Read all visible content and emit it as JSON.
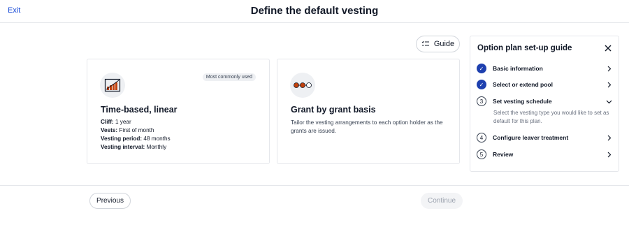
{
  "header": {
    "exit_label": "Exit",
    "title": "Define the default vesting"
  },
  "guide_button": {
    "label": "Guide",
    "icon": "checklist-icon"
  },
  "cards": [
    {
      "icon": "linear-chart-icon",
      "badge": "Most commonly used",
      "title": "Time-based, linear",
      "details": [
        {
          "key": "Cliff:",
          "value": "1 year"
        },
        {
          "key": "Vests:",
          "value": "First of month"
        },
        {
          "key": "Vesting period:",
          "value": "48 months"
        },
        {
          "key": "Vesting interval:",
          "value": "Monthly"
        }
      ]
    },
    {
      "icon": "grant-dots-icon",
      "title": "Grant by grant basis",
      "description": "Tailor the vesting arrangements to each option holder as the grants are issued."
    }
  ],
  "guide_panel": {
    "title": "Option plan set-up guide",
    "steps": [
      {
        "marker": "✓",
        "label": "Basic information",
        "status": "complete"
      },
      {
        "marker": "✓",
        "label": "Select or extend pool",
        "status": "complete"
      },
      {
        "marker": "3",
        "label": "Set vesting schedule",
        "status": "current",
        "description": "Select the vesting type you would like to set as default for this plan."
      },
      {
        "marker": "4",
        "label": "Configure leaver treatment",
        "status": "pending"
      },
      {
        "marker": "5",
        "label": "Review",
        "status": "pending"
      }
    ]
  },
  "footer": {
    "previous_label": "Previous",
    "continue_label": "Continue"
  },
  "colors": {
    "accent": "#1e40af",
    "link": "#1d4ed8",
    "icon_orange": "#c2410c",
    "disabled_text": "#9ca3af"
  }
}
